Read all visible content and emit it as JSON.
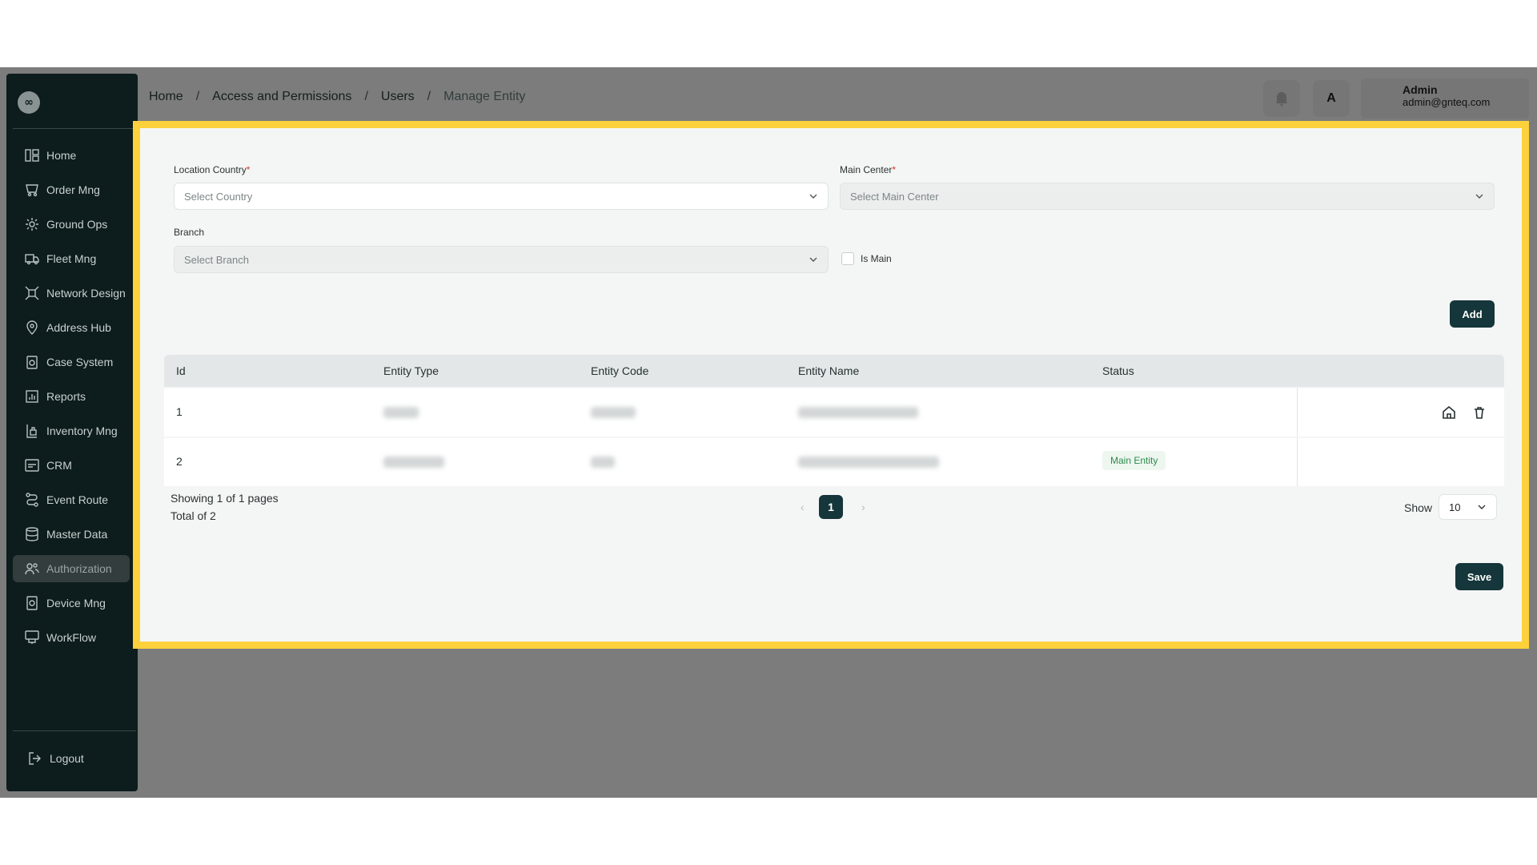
{
  "logo": {
    "glyph": "∞"
  },
  "sidebar": {
    "items": [
      {
        "label": "Home",
        "icon": "layout-icon"
      },
      {
        "label": "Order Mng",
        "icon": "order-icon"
      },
      {
        "label": "Ground Ops",
        "icon": "ground-ops-icon"
      },
      {
        "label": "Fleet Mng",
        "icon": "truck-icon"
      },
      {
        "label": "Network Design",
        "icon": "network-icon"
      },
      {
        "label": "Address Hub",
        "icon": "location-icon"
      },
      {
        "label": "Case System",
        "icon": "case-icon"
      },
      {
        "label": "Reports",
        "icon": "reports-icon"
      },
      {
        "label": "Inventory Mng",
        "icon": "inventory-icon"
      },
      {
        "label": "CRM",
        "icon": "crm-icon"
      },
      {
        "label": "Event Route",
        "icon": "route-icon"
      },
      {
        "label": "Master Data",
        "icon": "database-icon"
      },
      {
        "label": "Authorization",
        "icon": "users-icon",
        "active": true
      },
      {
        "label": "Device Mng",
        "icon": "device-icon"
      },
      {
        "label": "WorkFlow",
        "icon": "workflow-icon"
      }
    ],
    "logout": "Logout"
  },
  "breadcrumb": {
    "home": "Home",
    "access": "Access and Permissions",
    "users": "Users",
    "current": "Manage Entity",
    "separator": "/"
  },
  "header": {
    "user_name": "Admin",
    "user_email": "admin@gnteq.com",
    "translate_glyph": "A"
  },
  "form": {
    "country_label": "Location Country",
    "country_placeholder": "Select Country",
    "main_center_label": "Main Center",
    "main_center_placeholder": "Select Main Center",
    "branch_label": "Branch",
    "branch_placeholder": "Select Branch",
    "is_main_label": "Is Main",
    "required_mark": "*",
    "add_button": "Add"
  },
  "table": {
    "columns": [
      "Id",
      "Entity Type",
      "Entity Code",
      "Entity Name",
      "Status"
    ],
    "rows": [
      {
        "id": "1",
        "status": ""
      },
      {
        "id": "2",
        "status": "Main Entity"
      }
    ]
  },
  "pagination": {
    "showing": "Showing 1 of 1 pages",
    "total": "Total of 2",
    "current_page": "1",
    "show_label": "Show",
    "page_size": "10"
  },
  "save_button": "Save",
  "colors": {
    "accent": "#15363a",
    "highlight": "#fdd13c",
    "sidebar": "#0d1c1c",
    "badge_text": "#2c8a4c"
  }
}
